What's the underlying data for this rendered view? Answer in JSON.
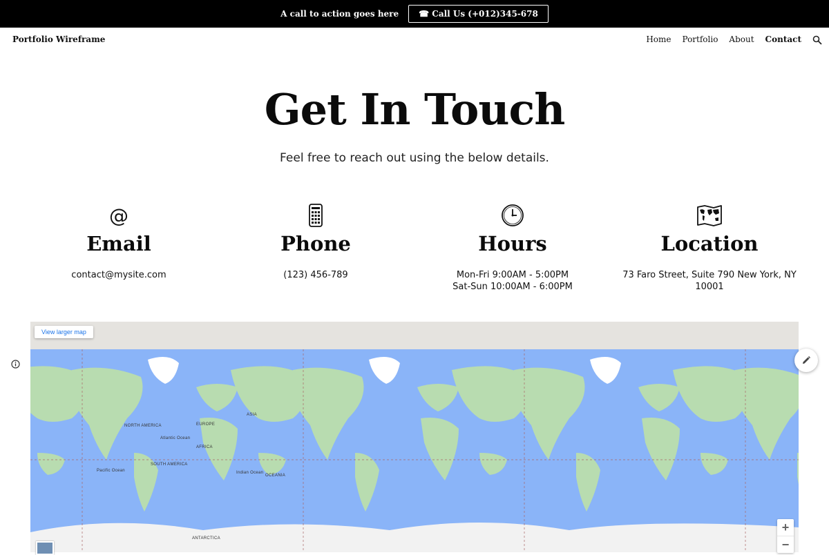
{
  "topbar": {
    "cta_text": "A call to action goes here",
    "call_label": "☎ Call Us (+012)345-678"
  },
  "header": {
    "brand": "Portfolio Wireframe",
    "nav": [
      "Home",
      "Portfolio",
      "About",
      "Contact"
    ],
    "active_nav": "Contact"
  },
  "hero": {
    "title": "Get In Touch",
    "subtitle": "Feel free to reach out using the below details."
  },
  "contacts": [
    {
      "icon": "at-sign-icon",
      "title": "Email",
      "value": "contact@mysite.com"
    },
    {
      "icon": "phone-icon",
      "title": "Phone",
      "value": "(123) 456-789"
    },
    {
      "icon": "clock-icon",
      "title": "Hours",
      "value_lines": [
        "Mon-Fri 9:00AM - 5:00PM",
        "Sat-Sun 10:00AM - 6:00PM"
      ]
    },
    {
      "icon": "map-icon",
      "title": "Location",
      "value_lines": [
        "73 Faro Street, Suite 790 New York, NY",
        "10001"
      ]
    }
  ],
  "map": {
    "larger_map_label": "View larger map",
    "zoom_in": "+",
    "zoom_out": "−",
    "labels": [
      "NORTH AMERICA",
      "EUROPE",
      "ASIA",
      "AFRICA",
      "SOUTH AMERICA",
      "OCEANIA",
      "ANTARCTICA",
      "Atlantic Ocean",
      "Pacific Ocean",
      "Indian Ocean"
    ],
    "colors": {
      "ocean": "#8ab4f8",
      "land": "#b8dcb0",
      "ice": "#f2f2f2"
    }
  }
}
